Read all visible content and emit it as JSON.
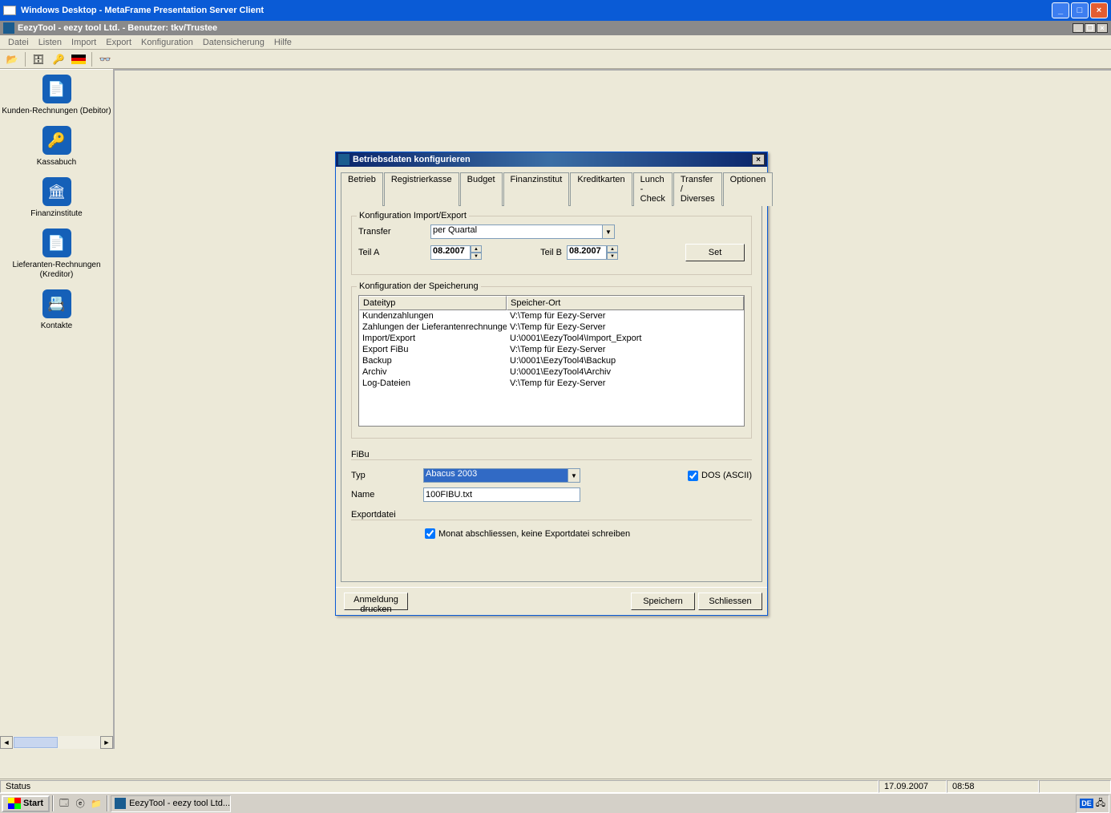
{
  "outer_window": {
    "title": "Windows Desktop - MetaFrame Presentation Server Client"
  },
  "inner_window": {
    "title": "EezyTool - eezy  tool Ltd. - Benutzer: tkv/Trustee"
  },
  "menubar": {
    "datei": "Datei",
    "listen": "Listen",
    "import": "Import",
    "export": "Export",
    "konfiguration": "Konfiguration",
    "datensicherung": "Datensicherung",
    "hilfe": "Hilfe"
  },
  "sidebar": {
    "items": [
      {
        "icon": "📄",
        "label": "Kunden-Rechnungen (Debitor)"
      },
      {
        "icon": "🔑",
        "label": "Kassabuch"
      },
      {
        "icon": "🏛",
        "label": "Finanzinstitute"
      },
      {
        "icon": "📄",
        "label": "Lieferanten-Rechnungen (Kreditor)"
      },
      {
        "icon": "📇",
        "label": "Kontakte"
      }
    ]
  },
  "dialog": {
    "title": "Betriebsdaten konfigurieren",
    "tabs": [
      "Betrieb",
      "Registrierkasse",
      "Budget",
      "Finanzinstitut",
      "Kreditkarten",
      "Lunch - Check",
      "Transfer / Diverses",
      "Optionen"
    ],
    "active_tab": 6,
    "group1": {
      "legend": "Konfiguration Import/Export",
      "transfer_label": "Transfer",
      "transfer_value": "per Quartal",
      "teila_label": "Teil A",
      "teila_value": "08.2007",
      "teilb_label": "Teil B",
      "teilb_value": "08.2007",
      "set_btn": "Set"
    },
    "group2": {
      "legend": "Konfiguration der Speicherung",
      "headers": {
        "col1": "Dateityp",
        "col2": "Speicher-Ort"
      },
      "rows": [
        {
          "c1": "Kundenzahlungen",
          "c2": "V:\\Temp für Eezy-Server"
        },
        {
          "c1": "Zahlungen der Lieferantenrechnungen",
          "c2": "V:\\Temp für Eezy-Server"
        },
        {
          "c1": "Import/Export",
          "c2": "U:\\0001\\EezyTool4\\Import_Export"
        },
        {
          "c1": "Export  FiBu",
          "c2": "V:\\Temp für Eezy-Server"
        },
        {
          "c1": "Backup",
          "c2": "U:\\0001\\EezyTool4\\Backup"
        },
        {
          "c1": "Archiv",
          "c2": "U:\\0001\\EezyTool4\\Archiv"
        },
        {
          "c1": "Log-Dateien",
          "c2": "V:\\Temp für Eezy-Server"
        }
      ]
    },
    "fibu": {
      "heading": "FiBu",
      "typ_label": "Typ",
      "typ_value": "Abacus 2003",
      "dos_label": "DOS (ASCII)",
      "name_label": "Name",
      "name_value": "100FIBU.txt",
      "export_label": "Exportdatei",
      "monat_label": "Monat abschliessen, keine Exportdatei schreiben"
    },
    "footer": {
      "anmeldung": "Anmeldung drucken",
      "speichern": "Speichern",
      "schliessen": "Schliessen"
    }
  },
  "statusbar": {
    "status": "Status",
    "date": "17.09.2007",
    "time": "08:58"
  },
  "taskbar": {
    "start": "Start",
    "task": "EezyTool - eezy  tool Ltd....",
    "lang": "DE"
  }
}
